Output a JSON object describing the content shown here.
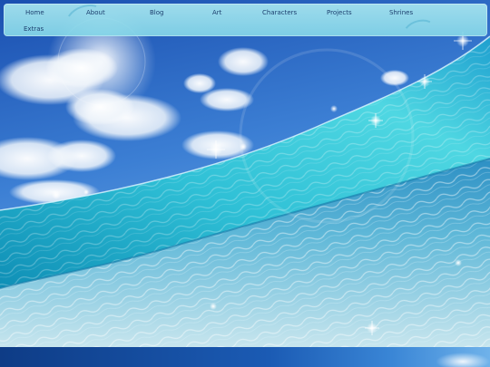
{
  "nav": {
    "items": [
      {
        "label": "Home"
      },
      {
        "label": "About"
      },
      {
        "label": "Blog"
      },
      {
        "label": "Art"
      },
      {
        "label": "Characters"
      },
      {
        "label": "Projects"
      },
      {
        "label": "Shrines"
      },
      {
        "label": "Extras"
      }
    ]
  },
  "colors": {
    "nav_background": "#9fe0ee",
    "nav_text": "#1d3f6e",
    "sky_top": "#1f55b8",
    "ocean_turquoise": "#38c6d8"
  }
}
